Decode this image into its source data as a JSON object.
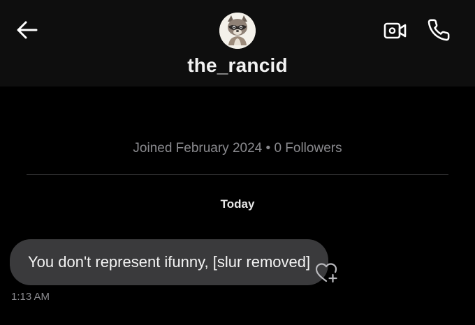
{
  "header": {
    "back_icon": "arrow-left-icon",
    "avatar_icon": "raccoon-avatar-icon",
    "username": "the_rancid",
    "video_icon": "video-camera-icon",
    "call_icon": "phone-icon"
  },
  "profile_info": {
    "joined_text": "Joined February 2024 • 0 Followers"
  },
  "conversation": {
    "day_label": "Today",
    "messages": [
      {
        "text": "You don't represent ifunny, [slur removed]",
        "time": "1:13 AM",
        "like_icon": "heart-plus-icon"
      }
    ]
  },
  "colors": {
    "background": "#000000",
    "header_background": "#0e0e0e",
    "bubble_background": "#3a3a3c",
    "muted_text": "#8a8a8e",
    "divider": "#3a3a3c"
  }
}
